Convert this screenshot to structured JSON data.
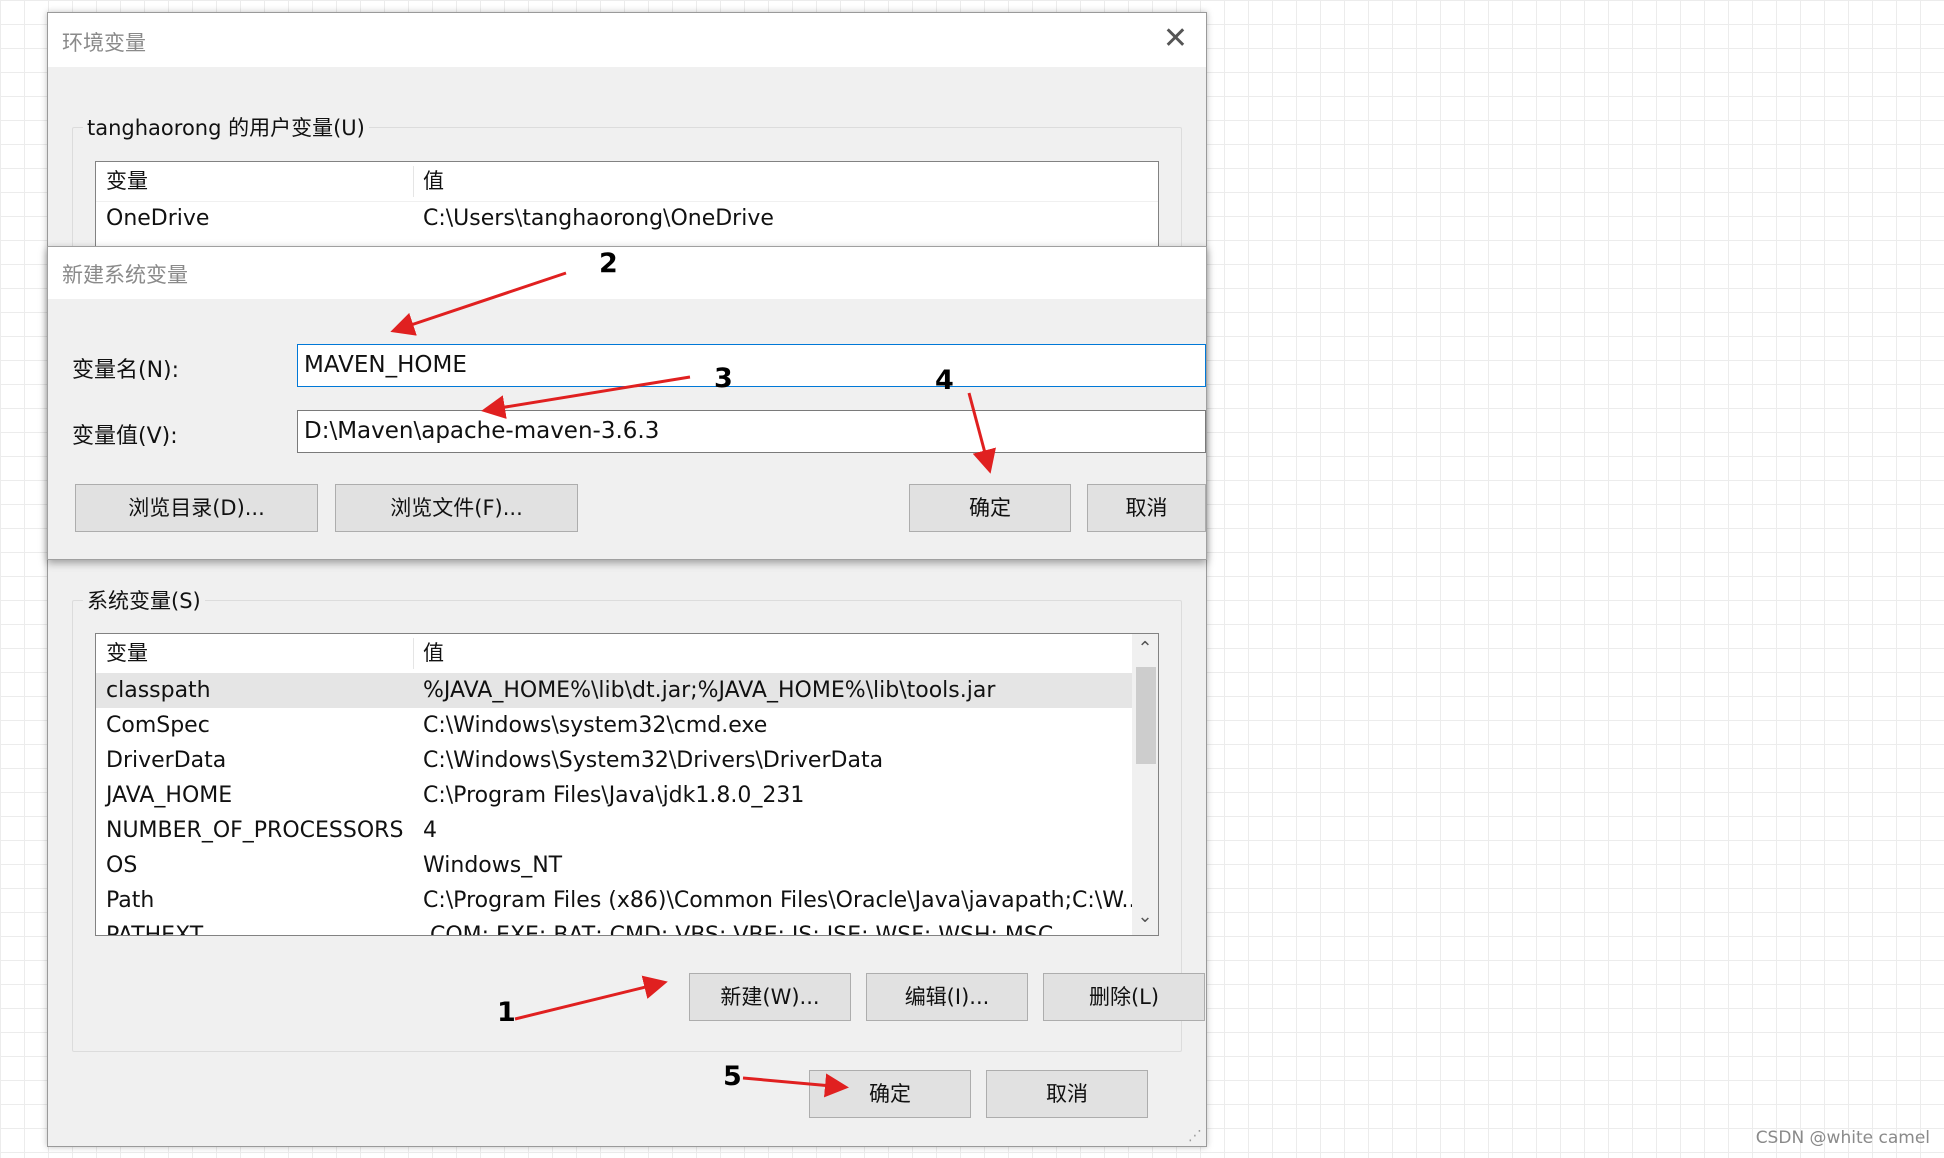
{
  "main_window": {
    "title": "环境变量",
    "user_group": {
      "label": "tanghaorong 的用户变量(U)",
      "col_var": "变量",
      "col_val": "值",
      "rows": [
        {
          "name": "OneDrive",
          "value": "C:\\Users\\tanghaorong\\OneDrive"
        }
      ]
    },
    "system_group": {
      "label": "系统变量(S)",
      "col_var": "变量",
      "col_val": "值",
      "rows": [
        {
          "name": "classpath",
          "value": "%JAVA_HOME%\\lib\\dt.jar;%JAVA_HOME%\\lib\\tools.jar"
        },
        {
          "name": "ComSpec",
          "value": "C:\\Windows\\system32\\cmd.exe"
        },
        {
          "name": "DriverData",
          "value": "C:\\Windows\\System32\\Drivers\\DriverData"
        },
        {
          "name": "JAVA_HOME",
          "value": "C:\\Program Files\\Java\\jdk1.8.0_231"
        },
        {
          "name": "NUMBER_OF_PROCESSORS",
          "value": "4"
        },
        {
          "name": "OS",
          "value": "Windows_NT"
        },
        {
          "name": "Path",
          "value": "C:\\Program Files (x86)\\Common Files\\Oracle\\Java\\javapath;C:\\W..."
        },
        {
          "name": "PATHEXT",
          "value": ".COM;.EXE;.BAT;.CMD;.VBS;.VBE;.JS;.JSE;.WSF;.WSH;.MSC"
        }
      ],
      "selected_index": 0,
      "btn_new": "新建(W)...",
      "btn_edit": "编辑(I)...",
      "btn_delete": "删除(L)"
    },
    "btn_ok": "确定",
    "btn_cancel": "取消"
  },
  "new_var_dialog": {
    "title": "新建系统变量",
    "name_label": "变量名(N):",
    "name_value": "MAVEN_HOME",
    "value_label": "变量值(V):",
    "value_value": "D:\\Maven\\apache-maven-3.6.3",
    "btn_browse_dir": "浏览目录(D)...",
    "btn_browse_file": "浏览文件(F)...",
    "btn_ok": "确定",
    "btn_cancel": "取消"
  },
  "annotations": {
    "n1": "1",
    "n2": "2",
    "n3": "3",
    "n4": "4",
    "n5": "5"
  },
  "annotation_color": "#e02020",
  "accent_color": "#0078d7",
  "watermark": "CSDN @white camel"
}
